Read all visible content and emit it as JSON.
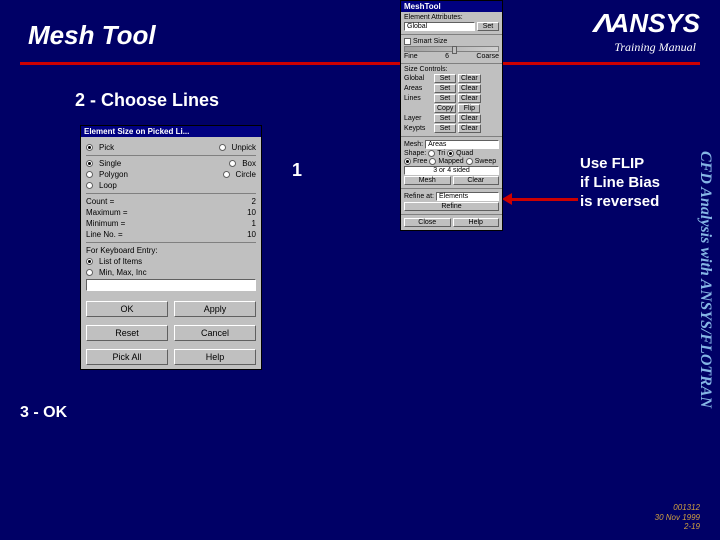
{
  "title": "Mesh Tool",
  "logo": "ANSYS",
  "training": "Training Manual",
  "subtitle": "2 - Choose Lines",
  "annot1": "1",
  "annot3": "3 - OK",
  "usenote_l1": "Use FLIP",
  "usenote_l2": "if Line Bias",
  "usenote_l3": "is reversed",
  "sidetext": "CFD Analysis with ANSYS/FLOTRAN",
  "footer_l1": "001312",
  "footer_l2": "30 Nov 1999",
  "footer_l3": "2-19",
  "meshtool": {
    "title": "MeshTool",
    "elemattr": "Element Attributes:",
    "global": "Global",
    "set": "Set",
    "smartsize": "Smart Size",
    "fine": "Fine",
    "coarse": "Coarse",
    "smartval": "6",
    "sizecontrols": "Size Controls:",
    "rows": {
      "global_lbl": "Global",
      "areas_lbl": "Areas",
      "lines_lbl": "Lines",
      "layer_lbl": "Layer",
      "keypts_lbl": "Keypts"
    },
    "setbtn": "Set",
    "clearbtn": "Clear",
    "copybtn": "Copy",
    "flipbtn": "Flip",
    "mesh_lbl": "Mesh:",
    "mesh_val": "Areas",
    "shape_lbl": "Shape:",
    "tri": "Tri",
    "quad": "Quad",
    "free": "Free",
    "mapped": "Mapped",
    "sweep": "Sweep",
    "sided": "3 or 4 sided",
    "meshbtn": "Mesh",
    "clearbtn2": "Clear",
    "refine_lbl": "Refine at:",
    "refine_val": "Elements",
    "refinebtn": "Refine",
    "close": "Close",
    "help": "Help"
  },
  "picker": {
    "title": "Element Size on Picked Li...",
    "pick": "Pick",
    "unpick": "Unpick",
    "single": "Single",
    "box": "Box",
    "polygon": "Polygon",
    "circle": "Circle",
    "loop": "Loop",
    "count_lbl": "Count",
    "count_val": "2",
    "max_lbl": "Maximum",
    "max_val": "10",
    "min_lbl": "Minimum",
    "min_val": "1",
    "lineno_lbl": "Line No.",
    "lineno_val": "10",
    "keyboard": "For Keyboard Entry:",
    "list": "List of Items",
    "minmax": "Min, Max, Inc",
    "ok": "OK",
    "apply": "Apply",
    "reset": "Reset",
    "cancel": "Cancel",
    "pickall": "Pick All",
    "help": "Help"
  }
}
